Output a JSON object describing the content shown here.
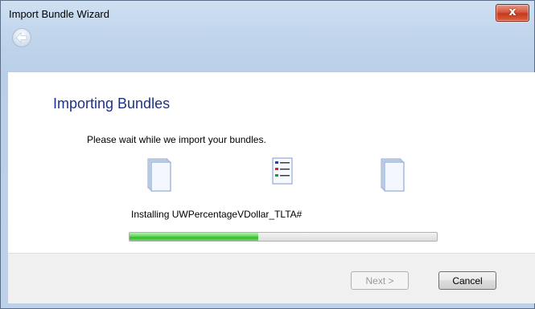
{
  "window": {
    "title": "Import Bundle Wizard"
  },
  "titlebar": {
    "close_label": "x"
  },
  "page": {
    "heading": "Importing Bundles",
    "description": "Please wait while we import your bundles.",
    "status": "Installing UWPercentageVDollar_TLTA#",
    "progress_fraction": 0.42
  },
  "icons": {
    "left": "document-icon",
    "center": "checklist-icon",
    "right": "document-icon"
  },
  "buttons": {
    "next": "Next >",
    "cancel": "Cancel"
  },
  "colors": {
    "heading": "#1e3287",
    "progress": "#4fca46",
    "close": "#c9442a"
  }
}
